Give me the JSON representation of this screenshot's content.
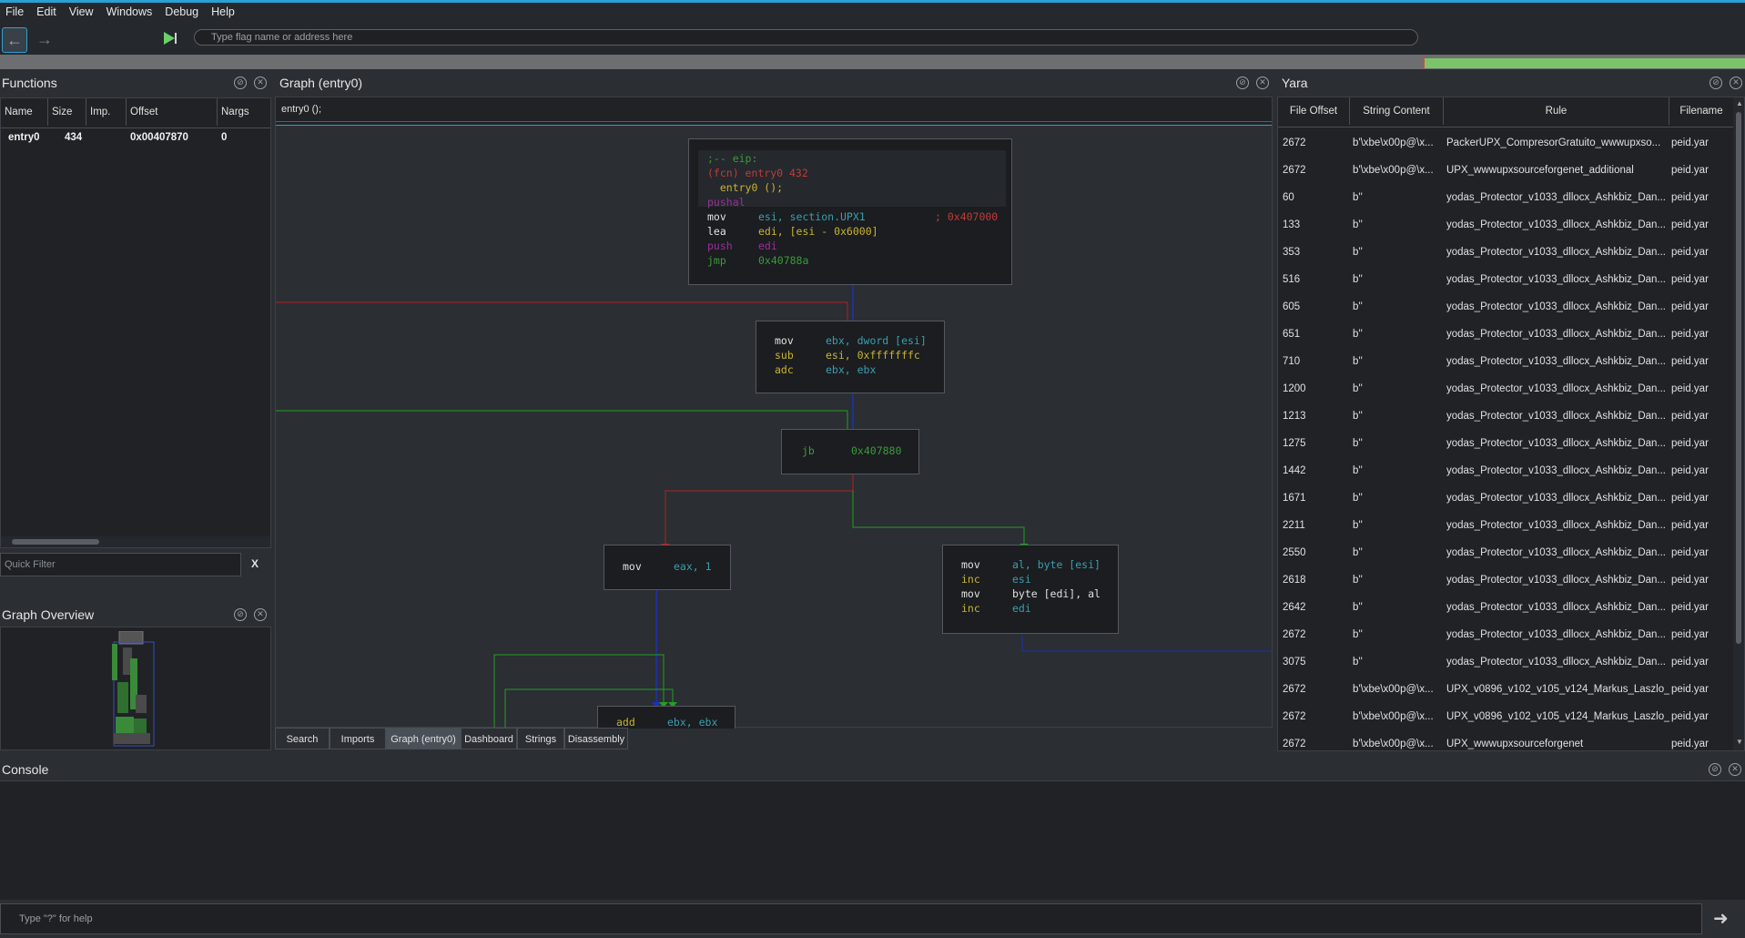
{
  "menu": [
    "File",
    "Edit",
    "View",
    "Windows",
    "Debug",
    "Help"
  ],
  "toolbar": {
    "address_placeholder": "Type flag name or address here"
  },
  "functions_panel": {
    "title": "Functions",
    "columns": [
      "Name",
      "Size",
      "Imp.",
      "Offset",
      "Nargs"
    ],
    "rows": [
      {
        "name": "entry0",
        "size": "434",
        "imp": "",
        "offset": "0x00407870",
        "nargs": "0"
      }
    ],
    "quick_filter_placeholder": "Quick Filter",
    "clear_label": "X"
  },
  "graph_overview": {
    "title": "Graph Overview"
  },
  "graph_panel": {
    "title": "Graph (entry0)",
    "signature": "entry0 ();",
    "block1": {
      "l1": ";-- eip:",
      "l2": "(fcn) entry0 432",
      "l3": "  entry0 ();",
      "l4": "pushal",
      "l5_op": "mov",
      "l5_args": "esi, section.UPX1",
      "l5_cmt": "; 0x407000",
      "l6_op": "lea",
      "l6_args": "edi, [esi - 0x6000]",
      "l7_op": "push",
      "l7_args": "edi",
      "l8_op": "jmp",
      "l8_args": "0x40788a"
    },
    "block2": {
      "l1_op": "mov",
      "l1_args": "ebx, dword [esi]",
      "l2_op": "sub",
      "l2_args": "esi, 0xfffffffc",
      "l3_op": "adc",
      "l3_args": "ebx, ebx"
    },
    "block3": {
      "op": "jb",
      "args": "0x407880"
    },
    "block4": {
      "op": "mov",
      "args": "eax, 1"
    },
    "block5": {
      "l1_op": "mov",
      "l1_args": "al, byte [esi]",
      "l2_op": "inc",
      "l2_args": "esi",
      "l3_op": "mov",
      "l3_args": "byte [edi], al",
      "l4_op": "inc",
      "l4_args": "edi"
    },
    "block6": {
      "op": "add",
      "args": "ebx, ebx"
    },
    "tabs": [
      "Search",
      "Imports",
      "Graph (entry0)",
      "Dashboard",
      "Strings",
      "Disassembly"
    ],
    "active_tab": "Graph (entry0)"
  },
  "yara_panel": {
    "title": "Yara",
    "columns": [
      "File Offset",
      "String Content",
      "Rule",
      "Filename"
    ],
    "rows": [
      {
        "offset": "2672",
        "content": "b'\\xbe\\x00p@\\x...",
        "rule": "PackerUPX_CompresorGratuito_wwwupxso...",
        "file": "peid.yar"
      },
      {
        "offset": "2672",
        "content": "b'\\xbe\\x00p@\\x...",
        "rule": "UPX_wwwupxsourceforgenet_additional",
        "file": "peid.yar"
      },
      {
        "offset": "60",
        "content": "b''",
        "rule": "yodas_Protector_v1033_dllocx_Ashkbiz_Dan...",
        "file": "peid.yar"
      },
      {
        "offset": "133",
        "content": "b''",
        "rule": "yodas_Protector_v1033_dllocx_Ashkbiz_Dan...",
        "file": "peid.yar"
      },
      {
        "offset": "353",
        "content": "b''",
        "rule": "yodas_Protector_v1033_dllocx_Ashkbiz_Dan...",
        "file": "peid.yar"
      },
      {
        "offset": "516",
        "content": "b''",
        "rule": "yodas_Protector_v1033_dllocx_Ashkbiz_Dan...",
        "file": "peid.yar"
      },
      {
        "offset": "605",
        "content": "b''",
        "rule": "yodas_Protector_v1033_dllocx_Ashkbiz_Dan...",
        "file": "peid.yar"
      },
      {
        "offset": "651",
        "content": "b''",
        "rule": "yodas_Protector_v1033_dllocx_Ashkbiz_Dan...",
        "file": "peid.yar"
      },
      {
        "offset": "710",
        "content": "b''",
        "rule": "yodas_Protector_v1033_dllocx_Ashkbiz_Dan...",
        "file": "peid.yar"
      },
      {
        "offset": "1200",
        "content": "b''",
        "rule": "yodas_Protector_v1033_dllocx_Ashkbiz_Dan...",
        "file": "peid.yar"
      },
      {
        "offset": "1213",
        "content": "b''",
        "rule": "yodas_Protector_v1033_dllocx_Ashkbiz_Dan...",
        "file": "peid.yar"
      },
      {
        "offset": "1275",
        "content": "b''",
        "rule": "yodas_Protector_v1033_dllocx_Ashkbiz_Dan...",
        "file": "peid.yar"
      },
      {
        "offset": "1442",
        "content": "b''",
        "rule": "yodas_Protector_v1033_dllocx_Ashkbiz_Dan...",
        "file": "peid.yar"
      },
      {
        "offset": "1671",
        "content": "b''",
        "rule": "yodas_Protector_v1033_dllocx_Ashkbiz_Dan...",
        "file": "peid.yar"
      },
      {
        "offset": "2211",
        "content": "b''",
        "rule": "yodas_Protector_v1033_dllocx_Ashkbiz_Dan...",
        "file": "peid.yar"
      },
      {
        "offset": "2550",
        "content": "b''",
        "rule": "yodas_Protector_v1033_dllocx_Ashkbiz_Dan...",
        "file": "peid.yar"
      },
      {
        "offset": "2618",
        "content": "b''",
        "rule": "yodas_Protector_v1033_dllocx_Ashkbiz_Dan...",
        "file": "peid.yar"
      },
      {
        "offset": "2642",
        "content": "b''",
        "rule": "yodas_Protector_v1033_dllocx_Ashkbiz_Dan...",
        "file": "peid.yar"
      },
      {
        "offset": "2672",
        "content": "b''",
        "rule": "yodas_Protector_v1033_dllocx_Ashkbiz_Dan...",
        "file": "peid.yar"
      },
      {
        "offset": "3075",
        "content": "b''",
        "rule": "yodas_Protector_v1033_dllocx_Ashkbiz_Dan...",
        "file": "peid.yar"
      },
      {
        "offset": "2672",
        "content": "b'\\xbe\\x00p@\\x...",
        "rule": "UPX_v0896_v102_v105_v124_Markus_Laszlo_...",
        "file": "peid.yar"
      },
      {
        "offset": "2672",
        "content": "b'\\xbe\\x00p@\\x...",
        "rule": "UPX_v0896_v102_v105_v124_Markus_Laszlo_...",
        "file": "peid.yar"
      },
      {
        "offset": "2672",
        "content": "b'\\xbe\\x00p@\\x...",
        "rule": "UPX_wwwupxsourceforgenet",
        "file": "peid.yar"
      }
    ]
  },
  "console": {
    "title": "Console",
    "input_placeholder": "Type \"?\" for help"
  },
  "colors": {
    "accent": "#2aa1d6",
    "jump_false": "#b22222",
    "jump_true": "#22a022",
    "flow": "#1e30b4",
    "mnemonic_default": "#dcdcdc",
    "mnemonic_arith": "#c8b432",
    "mnemonic_jump": "#3c9b3c",
    "mnemonic_stack": "#9b2f9b",
    "register": "#3a9fb0",
    "comment": "#c23b3b"
  }
}
